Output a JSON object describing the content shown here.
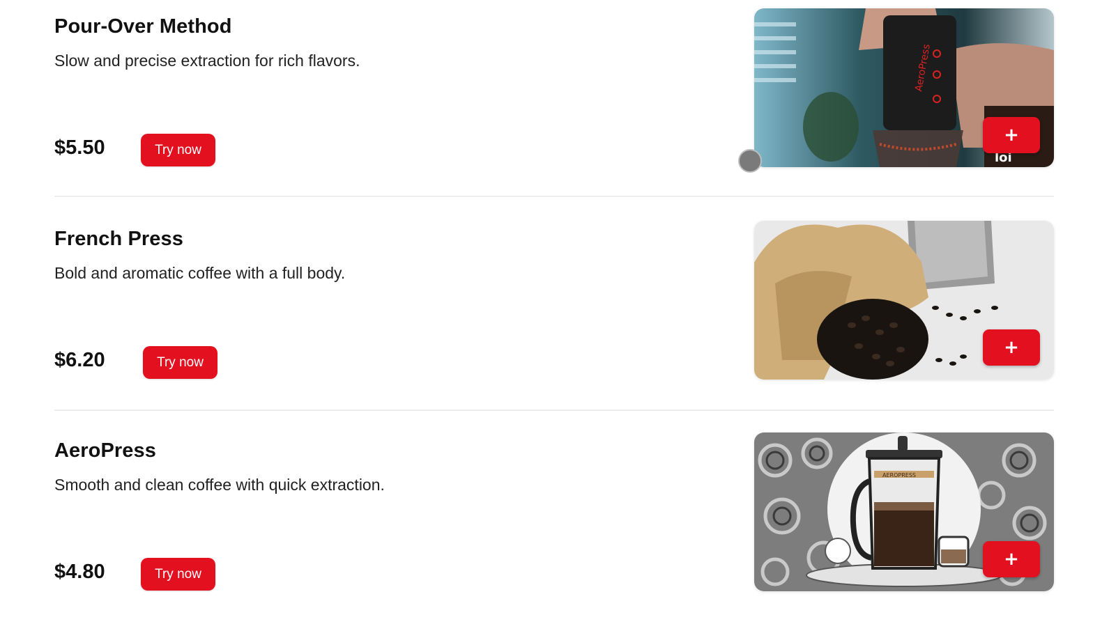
{
  "menu": {
    "items": [
      {
        "title": "Pour-Over Method",
        "description": "Slow and precise extraction for rich flavors.",
        "price": "$5.50",
        "cta_label": "Try now",
        "add_label": "+",
        "image_icon": "aeropress-photo"
      },
      {
        "title": "French Press",
        "description": "Bold and aromatic coffee with a full body.",
        "price": "$6.20",
        "cta_label": "Try now",
        "add_label": "+",
        "image_icon": "coffee-beans-bag-photo"
      },
      {
        "title": "AeroPress",
        "description": "Smooth and clean coffee with quick extraction.",
        "price": "$4.80",
        "cta_label": "Try now",
        "add_label": "+",
        "image_icon": "french-press-illustration"
      }
    ]
  },
  "colors": {
    "accent": "#e3101f",
    "text": "#111111",
    "divider": "#ececec",
    "background": "#ffffff"
  }
}
